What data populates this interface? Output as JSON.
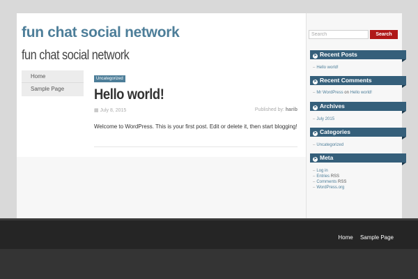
{
  "header": {
    "site_title": "fun chat social network",
    "site_description": "fun chat social network"
  },
  "left_nav": {
    "items": [
      {
        "label": "Home"
      },
      {
        "label": "Sample Page"
      }
    ]
  },
  "post": {
    "category": "Uncategorized",
    "title": "Hello world!",
    "date": "July 8, 2015",
    "published_by_prefix": "Published by:",
    "author": "harib",
    "body": "Welcome to WordPress. This is your first post. Edit or delete it, then start blogging!"
  },
  "search": {
    "placeholder": "Search",
    "button_label": "Search"
  },
  "sidebar": {
    "recent_posts": {
      "title": "Recent Posts",
      "items": [
        "Hello world!"
      ]
    },
    "recent_comments": {
      "title": "Recent Comments",
      "author": "Mr WordPress",
      "on": "on",
      "post": "Hello world!"
    },
    "archives": {
      "title": "Archives",
      "items": [
        "July 2015"
      ]
    },
    "categories": {
      "title": "Categories",
      "items": [
        "Uncategorized"
      ]
    },
    "meta": {
      "title": "Meta",
      "log_in": "Log in",
      "entries": "Entries",
      "comments": "Comments",
      "rss": "RSS",
      "wordpress_org": "WordPress.org"
    }
  },
  "footer_nav": {
    "items": [
      {
        "label": "Home"
      },
      {
        "label": "Sample Page"
      }
    ]
  },
  "colors": {
    "accent": "#4d7e99",
    "widget_header": "#355f7a",
    "search_button": "#b01818",
    "footer": "#252525"
  }
}
